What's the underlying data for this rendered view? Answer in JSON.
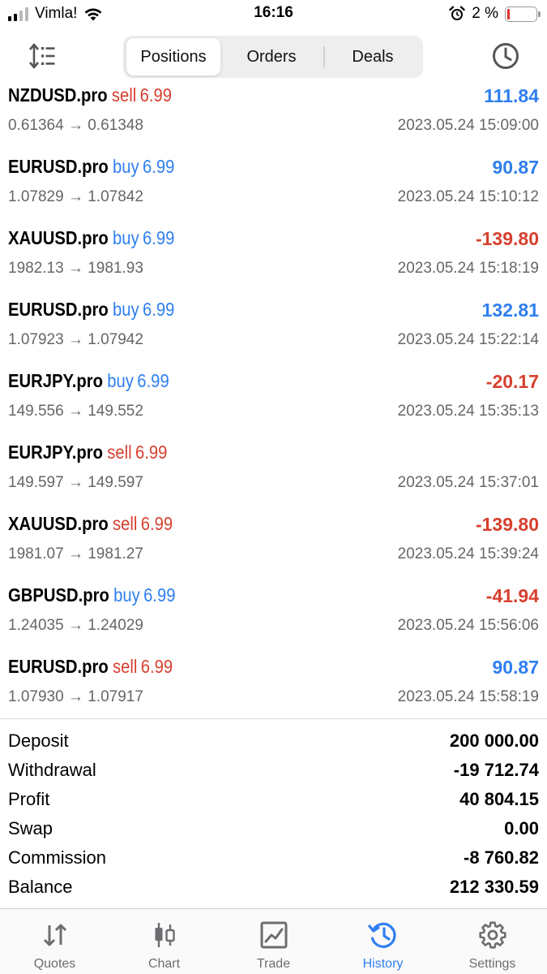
{
  "status_bar": {
    "carrier": "Vimla!",
    "time": "16:16",
    "battery_percent": "2 %",
    "signal_bars": 4,
    "signal_bars_filled": 2
  },
  "segments": {
    "items": [
      "Positions",
      "Orders",
      "Deals"
    ],
    "active": "Positions"
  },
  "colors": {
    "buy": "#2f7ff0",
    "sell": "#d7402f",
    "accent": "#2f7ff0",
    "muted_text": "#666666"
  },
  "deals": [
    {
      "symbol": "NZDUSD.pro",
      "direction": "sell",
      "volume": "6.99",
      "profit": "111.84",
      "prices": "0.61364 → 0.61348",
      "time": "2023.05.24 15:09:00"
    },
    {
      "symbol": "EURUSD.pro",
      "direction": "buy",
      "volume": "6.99",
      "profit": "90.87",
      "prices": "1.07829 → 1.07842",
      "time": "2023.05.24 15:10:12"
    },
    {
      "symbol": "XAUUSD.pro",
      "direction": "buy",
      "volume": "6.99",
      "profit": "-139.80",
      "prices": "1982.13 → 1981.93",
      "time": "2023.05.24 15:18:19"
    },
    {
      "symbol": "EURUSD.pro",
      "direction": "buy",
      "volume": "6.99",
      "profit": "132.81",
      "prices": "1.07923 → 1.07942",
      "time": "2023.05.24 15:22:14"
    },
    {
      "symbol": "EURJPY.pro",
      "direction": "buy",
      "volume": "6.99",
      "profit": "-20.17",
      "prices": "149.556 → 149.552",
      "time": "2023.05.24 15:35:13"
    },
    {
      "symbol": "EURJPY.pro",
      "direction": "sell",
      "volume": "6.99",
      "profit": "",
      "prices": "149.597 → 149.597",
      "time": "2023.05.24 15:37:01"
    },
    {
      "symbol": "XAUUSD.pro",
      "direction": "sell",
      "volume": "6.99",
      "profit": "-139.80",
      "prices": "1981.07 → 1981.27",
      "time": "2023.05.24 15:39:24"
    },
    {
      "symbol": "GBPUSD.pro",
      "direction": "buy",
      "volume": "6.99",
      "profit": "-41.94",
      "prices": "1.24035 → 1.24029",
      "time": "2023.05.24 15:56:06"
    },
    {
      "symbol": "EURUSD.pro",
      "direction": "sell",
      "volume": "6.99",
      "profit": "90.87",
      "prices": "1.07930 → 1.07917",
      "time": "2023.05.24 15:58:19"
    }
  ],
  "summary": [
    {
      "label": "Deposit",
      "value": "200 000.00"
    },
    {
      "label": "Withdrawal",
      "value": "-19 712.74"
    },
    {
      "label": "Profit",
      "value": "40 804.15"
    },
    {
      "label": "Swap",
      "value": "0.00"
    },
    {
      "label": "Commission",
      "value": "-8 760.82"
    },
    {
      "label": "Balance",
      "value": "212 330.59"
    }
  ],
  "tabs": [
    {
      "label": "Quotes",
      "icon": "quotes-icon"
    },
    {
      "label": "Chart",
      "icon": "chart-icon"
    },
    {
      "label": "Trade",
      "icon": "trade-icon"
    },
    {
      "label": "History",
      "icon": "history-icon",
      "active": true
    },
    {
      "label": "Settings",
      "icon": "gear-icon"
    }
  ]
}
